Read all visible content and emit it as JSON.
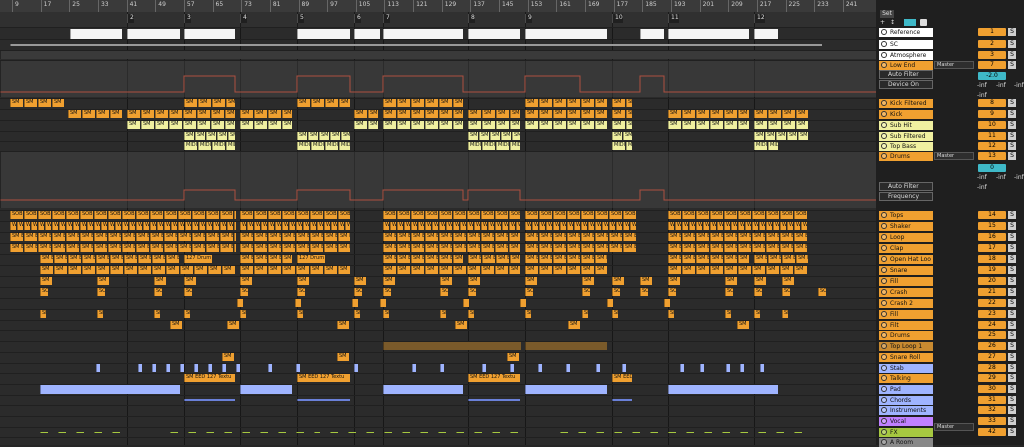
{
  "ruler": {
    "ticks": [
      "9",
      "17",
      "25",
      "33",
      "41",
      "49",
      "57",
      "65",
      "73",
      "81",
      "89",
      "97",
      "105",
      "113",
      "121",
      "129",
      "137",
      "145",
      "153",
      "161",
      "169",
      "177",
      "185",
      "193",
      "201",
      "209",
      "217",
      "225",
      "233",
      "241"
    ]
  },
  "locators": [
    "1",
    "2",
    "3",
    "4",
    "5",
    "6",
    "7",
    "8",
    "9",
    "10",
    "11",
    "12"
  ],
  "clip_labels": {
    "sm": "SM",
    "smsm": "SM SM SM",
    "sm_eed": "SM EED",
    "sob": "SOB",
    "w": "W",
    "midi": "MIDI",
    "drum": "127 Drum",
    "textu": "SM EED 127 Textu",
    "smeed_long": "SM EED SM EED SM EED"
  },
  "header": {
    "set_label": "Set"
  },
  "tracks": [
    {
      "name": "Reference",
      "num": "1",
      "color": "#ffffff"
    },
    {
      "name": "SC",
      "num": "2",
      "color": "#ffffff"
    },
    {
      "name": "Atmosphere",
      "num": "3",
      "color": "#ffffff"
    },
    {
      "name": "Low End",
      "num": "7",
      "color": "#f0a030"
    },
    {
      "name": "Kick Filtered",
      "num": "8",
      "color": "#f0a030"
    },
    {
      "name": "Kick",
      "num": "9",
      "color": "#f0a030"
    },
    {
      "name": "Sub Hit",
      "num": "10",
      "color": "#f0f0a0"
    },
    {
      "name": "Sub Filtered",
      "num": "11",
      "color": "#f0f0a0"
    },
    {
      "name": "Top Bass",
      "num": "12",
      "color": "#f0f0a0"
    },
    {
      "name": "Drums",
      "num": "13",
      "color": "#f0a030"
    },
    {
      "name": "Tops",
      "num": "14",
      "color": "#f0a030"
    },
    {
      "name": "Shaker",
      "num": "15",
      "color": "#f0a030"
    },
    {
      "name": "Loop",
      "num": "16",
      "color": "#f0a030"
    },
    {
      "name": "Clap",
      "num": "17",
      "color": "#f0a030"
    },
    {
      "name": "Open Hat Loo",
      "num": "18",
      "color": "#f0a030"
    },
    {
      "name": "Snare",
      "num": "19",
      "color": "#f0a030"
    },
    {
      "name": "Fill",
      "num": "20",
      "color": "#f0a030"
    },
    {
      "name": "Crash",
      "num": "21",
      "color": "#f0a030"
    },
    {
      "name": "Crash 2",
      "num": "22",
      "color": "#f0a030"
    },
    {
      "name": "Fill",
      "num": "23",
      "color": "#f0a030"
    },
    {
      "name": "Filt",
      "num": "24",
      "color": "#f0a030"
    },
    {
      "name": "Drums",
      "num": "25",
      "color": "#f0a030"
    },
    {
      "name": "Top Loop 1",
      "num": "26",
      "color": "#c88a30"
    },
    {
      "name": "Snare Roll",
      "num": "27",
      "color": "#f0a030"
    },
    {
      "name": "Stab",
      "num": "28",
      "color": "#9fb4ff"
    },
    {
      "name": "Talking",
      "num": "29",
      "color": "#f0a030"
    },
    {
      "name": "Pad",
      "num": "30",
      "color": "#9fb4ff"
    },
    {
      "name": "Chords",
      "num": "31",
      "color": "#9fb4ff"
    },
    {
      "name": "Instruments",
      "num": "32",
      "color": "#9fb4ff"
    },
    {
      "name": "Vocal",
      "num": "33",
      "color": "#c080ff"
    },
    {
      "name": "FX",
      "num": "42",
      "color": "#a6c840"
    },
    {
      "name": "A Room",
      "num": "",
      "color": "#888888"
    }
  ],
  "devices": {
    "auto_filter": "Auto Filter",
    "device_on": "Device On",
    "frequency": "Frequency",
    "master": "Master",
    "inf": "-inf",
    "gain": "-2.0",
    "zero": "0",
    "s": "S",
    "c": "C"
  }
}
